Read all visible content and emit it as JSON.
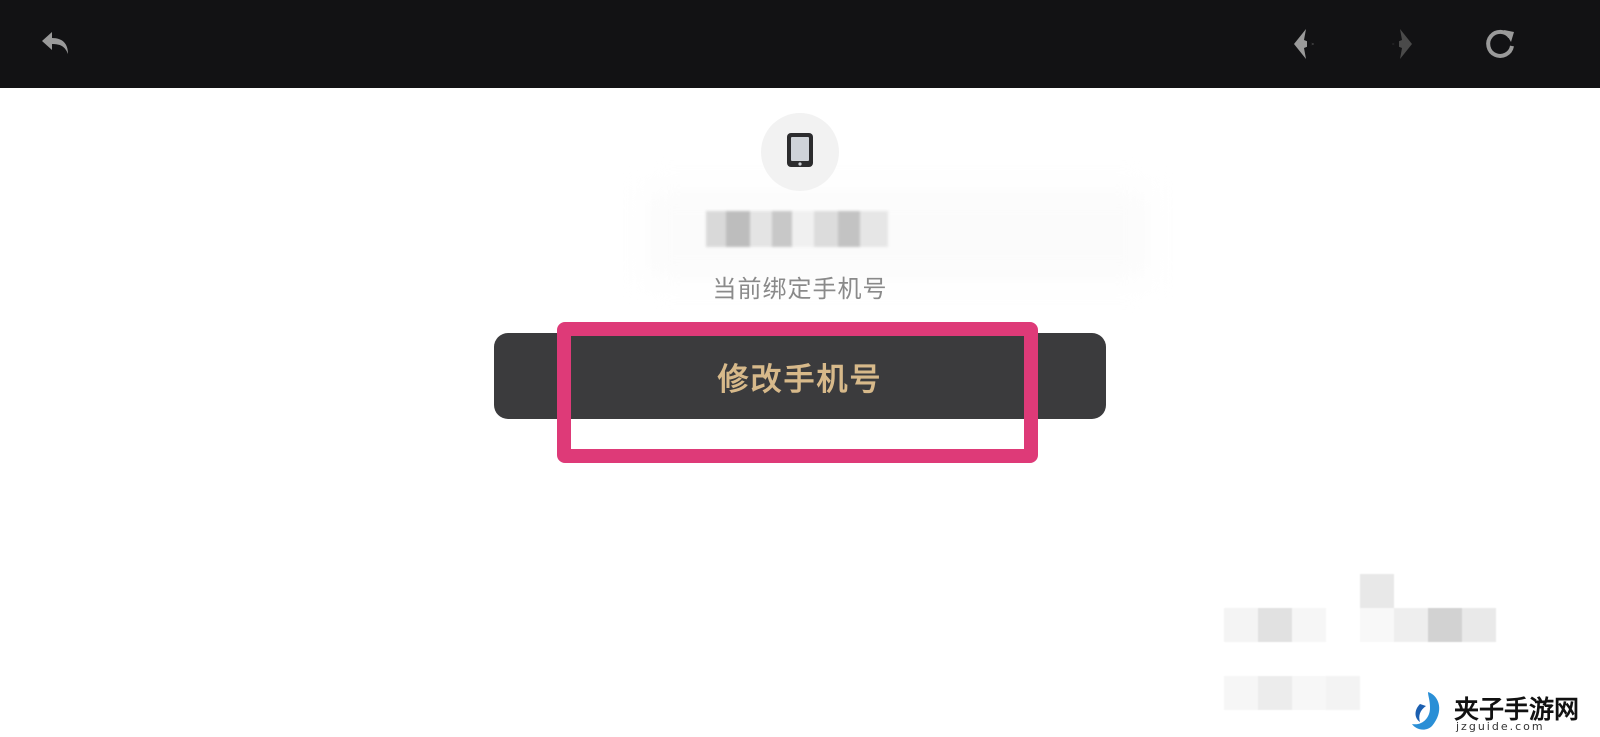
{
  "toolbar": {
    "icons": {
      "back": "undo-arrow-icon",
      "prev": "back-arrow-icon",
      "next": "forward-arrow-icon",
      "refresh": "refresh-icon"
    }
  },
  "main": {
    "icon": "smartphone-icon",
    "phone_number_masked": true,
    "bound_label": "当前绑定手机号",
    "change_button_label": "修改手机号"
  },
  "annotation": {
    "highlight_color": "#de3a78"
  },
  "watermark": {
    "brand": "夹子手游网",
    "domain": "jzguide.com"
  },
  "colors": {
    "topbar": "#121214",
    "button_bg": "#3b3b3d",
    "button_text": "#d7b98a",
    "label_text": "#8a8a8a"
  }
}
